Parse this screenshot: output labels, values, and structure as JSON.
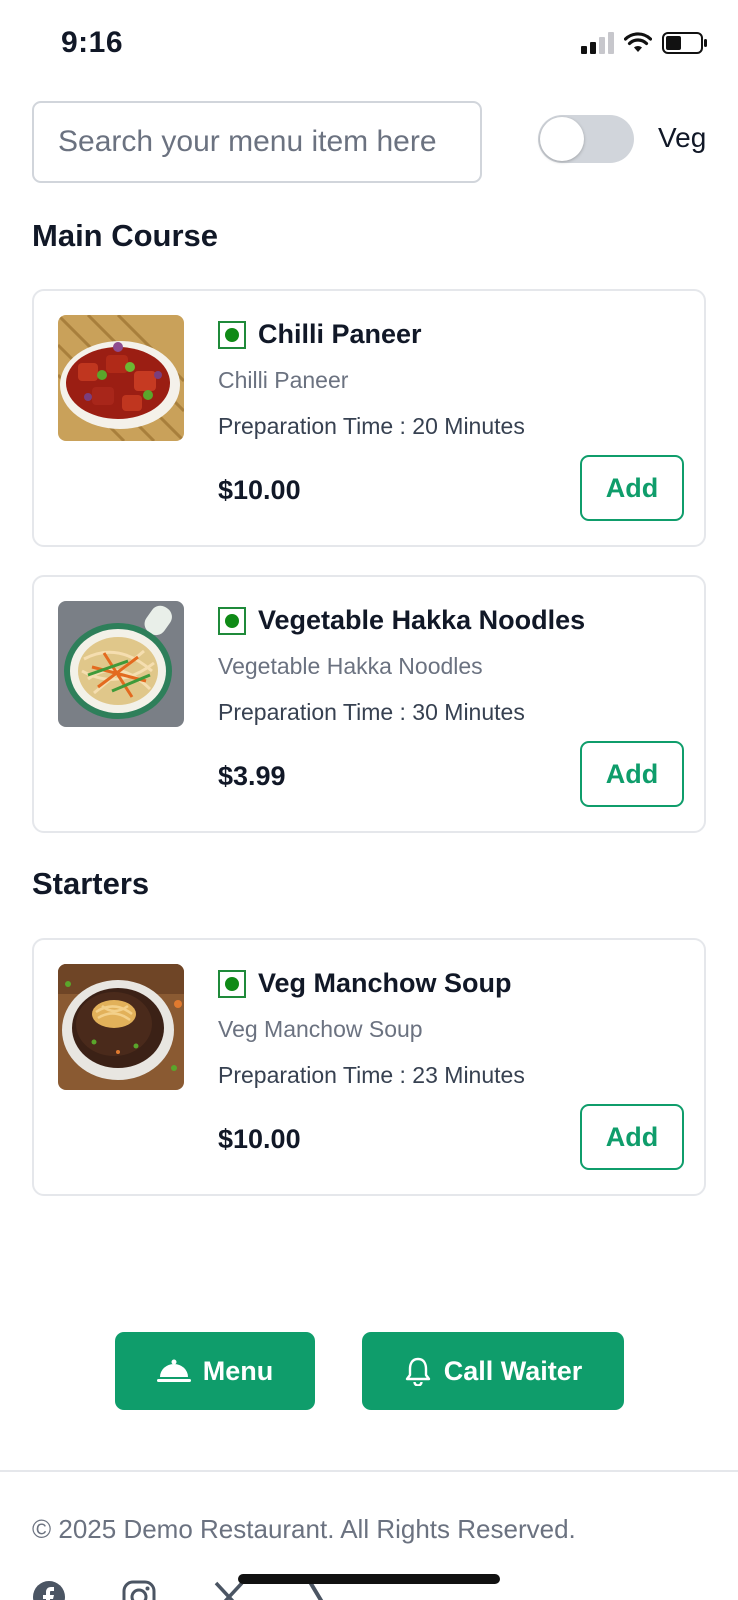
{
  "status_bar": {
    "time": "9:16"
  },
  "search": {
    "placeholder": "Search your menu item here"
  },
  "veg_filter": {
    "label": "Veg",
    "enabled": false
  },
  "sections": [
    {
      "title": "Main Course",
      "items": [
        {
          "name": "Chilli Paneer",
          "description": "Chilli Paneer",
          "prep_time": "Preparation Time : 20 Minutes",
          "price": "$10.00",
          "add_label": "Add",
          "image": "chilli-paneer-photo"
        },
        {
          "name": "Vegetable Hakka Noodles",
          "description": "Vegetable Hakka Noodles",
          "prep_time": "Preparation Time : 30 Minutes",
          "price": "$3.99",
          "add_label": "Add",
          "image": "hakka-noodles-photo"
        }
      ]
    },
    {
      "title": "Starters",
      "items": [
        {
          "name": "Veg Manchow Soup",
          "description": "Veg Manchow Soup",
          "prep_time": "Preparation Time : 23 Minutes",
          "price": "$10.00",
          "add_label": "Add",
          "image": "manchow-soup-photo"
        }
      ]
    }
  ],
  "actions": {
    "menu_label": "Menu",
    "call_waiter_label": "Call Waiter"
  },
  "footer": {
    "copyright": "© 2025 Demo Restaurant. All Rights Reserved.",
    "social_icons": [
      "facebook-icon",
      "instagram-icon",
      "x-icon",
      "tripadvisor-icon"
    ]
  },
  "colors": {
    "accent": "#0f9d6b",
    "veg": "#0f8a16",
    "border": "#e5e7eb",
    "muted": "#6b7280"
  }
}
